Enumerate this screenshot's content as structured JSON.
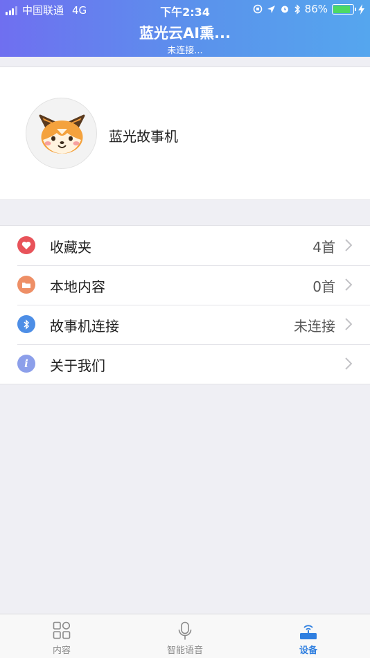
{
  "status_bar": {
    "carrier": "中国联通",
    "network": "4G",
    "time": "下午2:34",
    "battery_percent": "86%",
    "battery_level": 0.86
  },
  "nav": {
    "title": "蓝光云AI熏...",
    "subtitle": "未连接..."
  },
  "profile": {
    "device_name": "蓝光故事机",
    "avatar_icon": "fox-avatar-icon"
  },
  "menu": {
    "items": [
      {
        "label": "收藏夹",
        "value": "4首",
        "icon": "heart-icon",
        "color": "#e8535a"
      },
      {
        "label": "本地内容",
        "value": "0首",
        "icon": "folder-icon",
        "color": "#ee8f66"
      },
      {
        "label": "故事机连接",
        "value": "未连接",
        "icon": "bluetooth-icon",
        "color": "#4d8ee6"
      },
      {
        "label": "关于我们",
        "value": "",
        "icon": "info-icon",
        "color": "#8c9fea"
      }
    ]
  },
  "tabbar": {
    "tabs": [
      {
        "label": "内容",
        "icon": "grid-icon",
        "active": false
      },
      {
        "label": "智能语音",
        "icon": "microphone-icon",
        "active": false
      },
      {
        "label": "设备",
        "icon": "router-icon",
        "active": true
      }
    ],
    "active_color": "#2f7fe0"
  }
}
